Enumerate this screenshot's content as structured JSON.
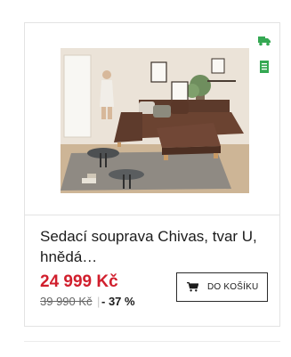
{
  "product": {
    "name": "Sedací souprava Chivas, tvar U, hnědá…",
    "price": "24 999 Kč",
    "old_price": "39 990 Kč",
    "price_separator": "|",
    "discount": "- 37 %",
    "image_alt": "Hnědá sedací souprava ve tvaru U v obývacím pokoji"
  },
  "cart_button": {
    "label": "DO KOŠÍKU",
    "icon": "cart-icon"
  },
  "badges": {
    "delivery_icon": "truck-icon",
    "document_icon": "document-icon"
  },
  "colors": {
    "price": "#d11f2d",
    "badge": "#35a853",
    "border": "#e3e3e3"
  }
}
